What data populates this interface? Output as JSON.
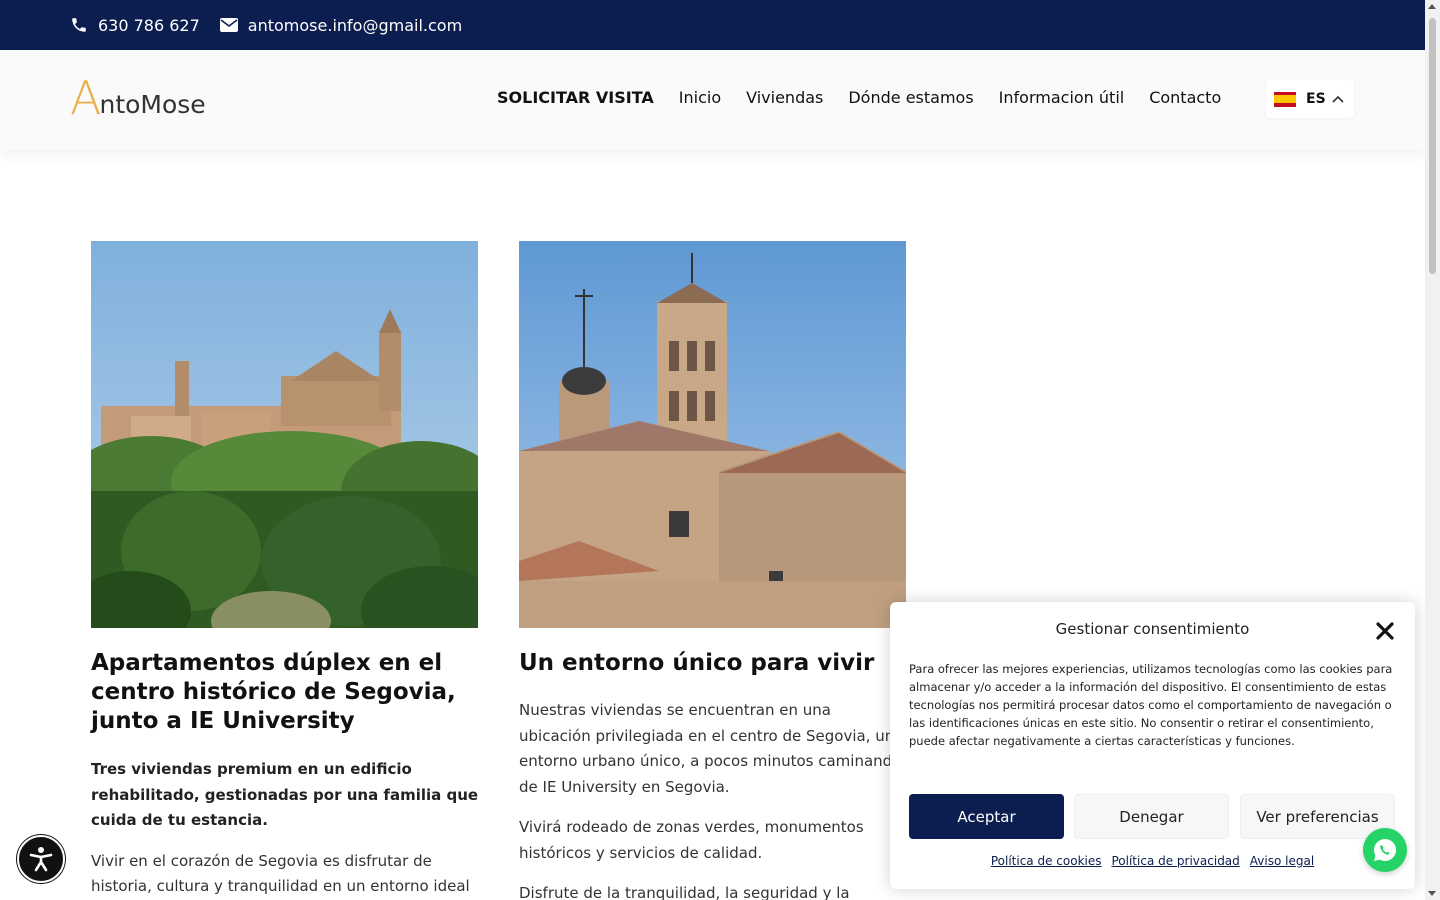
{
  "topbar": {
    "phone": "630 786 627",
    "email": "antomose.info@gmail.com",
    "phone_icon": "phone-icon",
    "email_icon": "envelope-icon"
  },
  "header": {
    "logo_letter": "A",
    "logo_rest": "ntoMose",
    "nav": [
      {
        "label": "SOLICITAR VISITA"
      },
      {
        "label": "Inicio"
      },
      {
        "label": "Viviendas"
      },
      {
        "label": "Dónde estamos"
      },
      {
        "label": "Informacion útil"
      },
      {
        "label": "Contacto"
      }
    ],
    "language": {
      "code": "ES",
      "flag_icon": "spain-flag-icon"
    }
  },
  "columns": [
    {
      "image": "segovia-cathedral-panorama",
      "title": "Apartamentos dúplex en el centro histórico de Segovia, junto a IE University",
      "lead": "Tres viviendas premium en un edificio rehabilitado, gestionadas por una familia que cuida de tu estancia.",
      "paragraphs": [
        "Vivir en el corazón de Segovia es disfrutar de historia, cultura y tranquilidad en un entorno ideal"
      ]
    },
    {
      "image": "segovia-church-tower",
      "title": "Un entorno único para vivir",
      "paragraphs": [
        "Nuestras viviendas se encuentran en una ubicación privilegiada en el centro de Segovia, un entorno urbano único, a pocos minutos caminando de IE University en Segovia.",
        "Vivirá rodeado de zonas verdes, monumentos históricos y servicios de calidad.",
        "Disfrute de la tranquilidad, la seguridad y la"
      ]
    }
  ],
  "consent": {
    "title": "Gestionar consentimiento",
    "body": "Para ofrecer las mejores experiencias, utilizamos tecnologías como las cookies para almacenar y/o acceder a la información del dispositivo. El consentimiento de estas tecnologías nos permitirá procesar datos como el comportamiento de navegación o las identificaciones únicas en este sitio. No consentir o retirar el consentimiento, puede afectar negativamente a ciertas características y funciones.",
    "accept": "Aceptar",
    "deny": "Denegar",
    "preferences": "Ver preferencias",
    "links": [
      "Política de cookies",
      "Política de privacidad",
      "Aviso legal"
    ]
  },
  "colors": {
    "navy": "#0b1e4f",
    "logo_gold": "#e6b04a",
    "whatsapp_green": "#25d366"
  }
}
